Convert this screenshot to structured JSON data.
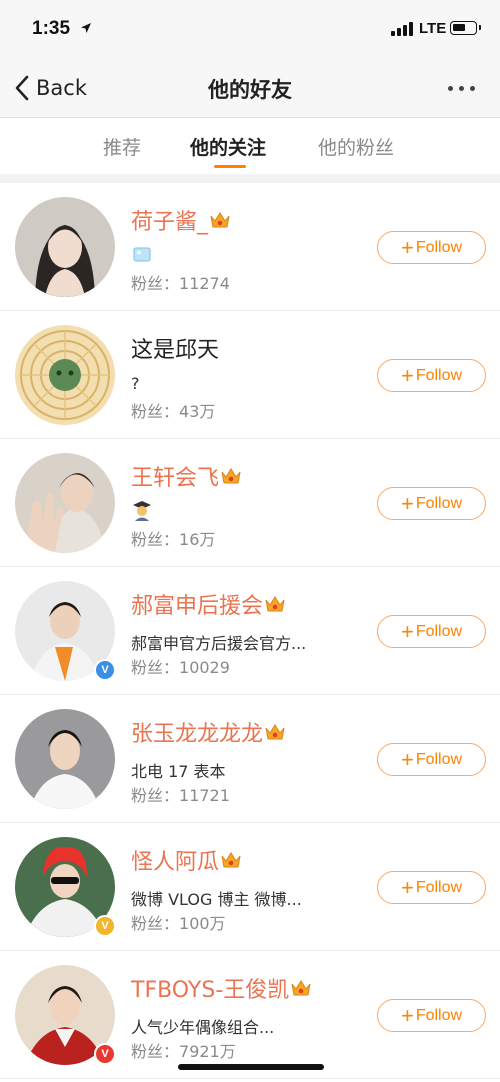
{
  "status_bar": {
    "time": "1:35",
    "network": "LTE",
    "icons": [
      "location-arrow-icon",
      "cellular-signal-icon",
      "battery-icon"
    ]
  },
  "nav": {
    "back_label": "Back",
    "title": "他的好友",
    "more_icon": "ellipsis-icon"
  },
  "tabs": [
    {
      "label": "推荐",
      "active": false
    },
    {
      "label": "他的关注",
      "active": true
    },
    {
      "label": "他的粉丝",
      "active": false
    }
  ],
  "accent_color": "#ff8200",
  "vip_name_color": "#eb7350",
  "fans_label": "粉丝：",
  "follow_label": "Follow",
  "users": [
    {
      "name": "荷子酱_",
      "vip": true,
      "desc": "",
      "desc_icon": "ice-cube-emoji-icon",
      "fans": "11274",
      "verified": ""
    },
    {
      "name": "这是邱天",
      "vip": false,
      "desc": "?",
      "desc_icon": "",
      "fans": "43万",
      "verified": ""
    },
    {
      "name": "王轩会飞",
      "vip": true,
      "desc": "",
      "desc_icon": "student-emoji-icon",
      "fans": "16万",
      "verified": ""
    },
    {
      "name": "郝富申后援会",
      "vip": true,
      "desc": "郝富申官方后援会官方...",
      "desc_icon": "",
      "fans": "10029",
      "verified": "blue"
    },
    {
      "name": "张玉龙龙龙龙",
      "vip": true,
      "desc": "北电 17 表本",
      "desc_icon": "",
      "fans": "11721",
      "verified": ""
    },
    {
      "name": "怪人阿瓜",
      "vip": true,
      "desc": "微博 VLOG 博主 微博...",
      "desc_icon": "",
      "fans": "100万",
      "verified": "gold"
    },
    {
      "name": "TFBOYS-王俊凯",
      "vip": true,
      "desc": "人气少年偶像组合...",
      "desc_icon": "",
      "fans": "7921万",
      "verified": "red"
    }
  ]
}
